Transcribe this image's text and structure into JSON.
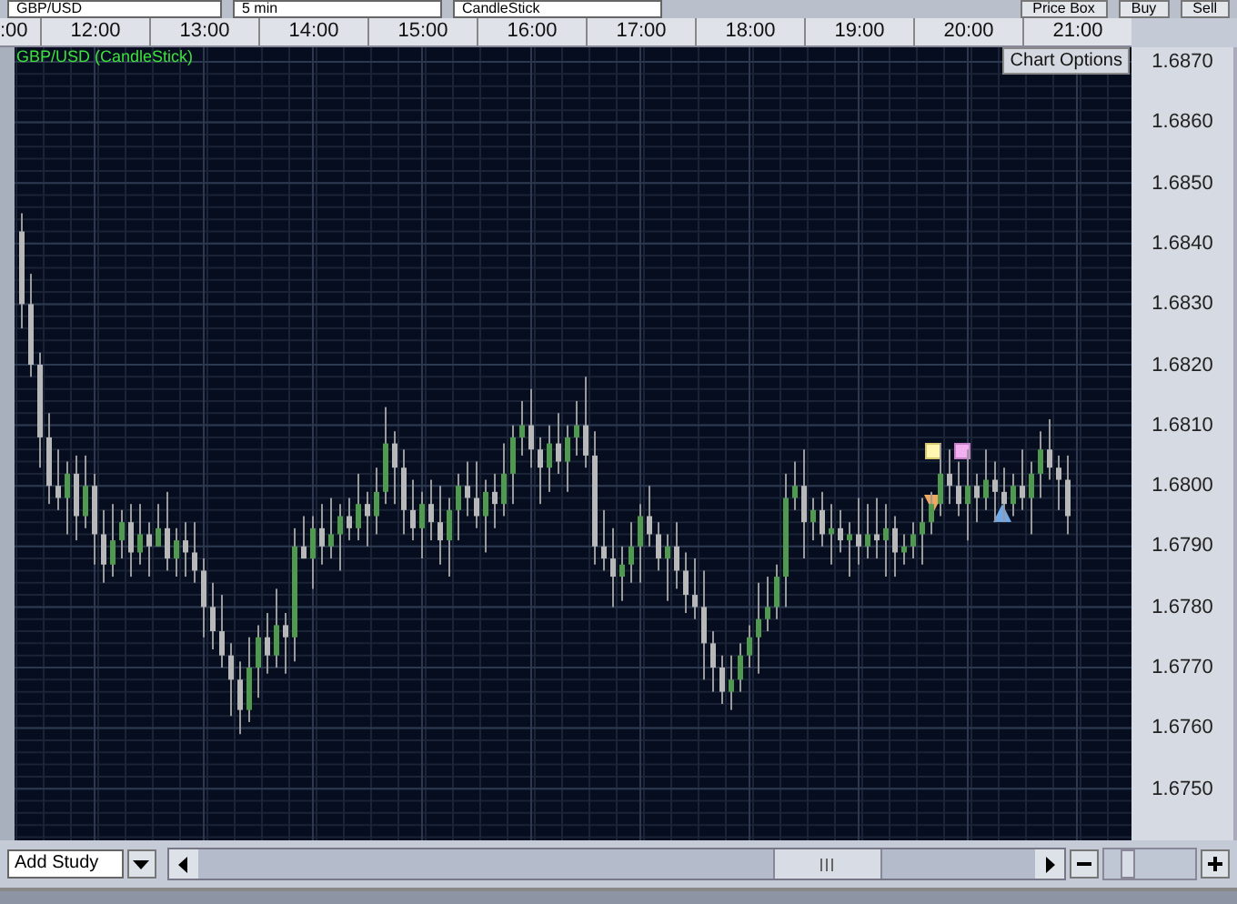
{
  "toolbar": {
    "symbol": "GBP/USD",
    "interval": "5 min",
    "chart_type": "CandleStick",
    "buttons": [
      "Price Box",
      "Buy",
      "Sell"
    ]
  },
  "chart": {
    "options_button": "Chart Options",
    "chart_data": {
      "type": "candlestick",
      "title": "GBP/USD (CandleStick)",
      "grid": true,
      "xlim": [
        11.2667,
        21.5
      ],
      "ylim": [
        1.67415,
        1.68724
      ],
      "xticks": [
        {
          "value": 12,
          "label": "12:00"
        },
        {
          "value": 13,
          "label": "13:00"
        },
        {
          "value": 14,
          "label": "14:00"
        },
        {
          "value": 15,
          "label": "15:00"
        },
        {
          "value": 16,
          "label": "16:00"
        },
        {
          "value": 17,
          "label": "17:00"
        },
        {
          "value": 18,
          "label": "18:00"
        },
        {
          "value": 19,
          "label": "19:00"
        },
        {
          "value": 20,
          "label": "20:00"
        },
        {
          "value": 21,
          "label": "21:00"
        }
      ],
      "yticks": [
        {
          "value": 1.687,
          "label": "1.6870"
        },
        {
          "value": 1.686,
          "label": "1.6860"
        },
        {
          "value": 1.685,
          "label": "1.6850"
        },
        {
          "value": 1.684,
          "label": "1.6840"
        },
        {
          "value": 1.683,
          "label": "1.6830"
        },
        {
          "value": 1.682,
          "label": "1.6820"
        },
        {
          "value": 1.681,
          "label": "1.6810"
        },
        {
          "value": 1.68,
          "label": "1.6800"
        },
        {
          "value": 1.679,
          "label": "1.6790"
        },
        {
          "value": 1.678,
          "label": "1.6780"
        },
        {
          "value": 1.677,
          "label": "1.6770"
        },
        {
          "value": 1.676,
          "label": "1.6760"
        },
        {
          "value": 1.675,
          "label": "1.6750"
        }
      ],
      "x": [
        11.3333,
        11.4167,
        11.5,
        11.5833,
        11.6667,
        11.75,
        11.8333,
        11.9167,
        12,
        12.0833,
        12.1667,
        12.25,
        12.3333,
        12.4167,
        12.5,
        12.5833,
        12.6667,
        12.75,
        12.8333,
        12.9167,
        13,
        13.0833,
        13.1667,
        13.25,
        13.3333,
        13.4167,
        13.5,
        13.5833,
        13.6667,
        13.75,
        13.8333,
        13.9167,
        14,
        14.0833,
        14.1667,
        14.25,
        14.3333,
        14.4167,
        14.5,
        14.5833,
        14.6667,
        14.75,
        14.8333,
        14.9167,
        15,
        15.0833,
        15.1667,
        15.25,
        15.3333,
        15.4167,
        15.5,
        15.5833,
        15.6667,
        15.75,
        15.8333,
        15.9167,
        16,
        16.0833,
        16.1667,
        16.25,
        16.3333,
        16.4167,
        16.5,
        16.5833,
        16.6667,
        16.75,
        16.8333,
        16.9167,
        17,
        17.0833,
        17.1667,
        17.25,
        17.3333,
        17.4167,
        17.5,
        17.5833,
        17.6667,
        17.75,
        17.8333,
        17.9167,
        18,
        18.0833,
        18.1667,
        18.25,
        18.3333,
        18.4167,
        18.5,
        18.5833,
        18.6667,
        18.75,
        18.8333,
        18.9167,
        19,
        19.0833,
        19.1667,
        19.25,
        19.3333,
        19.4167,
        19.5,
        19.5833,
        19.6667,
        19.75,
        19.8333,
        19.9167,
        20,
        20.0833,
        20.1667,
        20.25,
        20.3333,
        20.4167,
        20.5,
        20.5833,
        20.6667,
        20.75,
        20.8333,
        20.9167
      ],
      "ohlc": [
        [
          1.6842,
          1.6845,
          1.6826,
          1.683
        ],
        [
          1.683,
          1.6835,
          1.6818,
          1.682
        ],
        [
          1.682,
          1.6822,
          1.6803,
          1.6808
        ],
        [
          1.6808,
          1.6812,
          1.6797,
          1.68
        ],
        [
          1.68,
          1.6806,
          1.6796,
          1.6798
        ],
        [
          1.6798,
          1.6804,
          1.6792,
          1.6802
        ],
        [
          1.6802,
          1.6805,
          1.6791,
          1.6795
        ],
        [
          1.6795,
          1.6805,
          1.6793,
          1.68
        ],
        [
          1.68,
          1.6802,
          1.6787,
          1.6792
        ],
        [
          1.6792,
          1.6796,
          1.6784,
          1.6787
        ],
        [
          1.6787,
          1.6797,
          1.6785,
          1.6791
        ],
        [
          1.6791,
          1.6796,
          1.6788,
          1.6794
        ],
        [
          1.6794,
          1.6797,
          1.6785,
          1.6789
        ],
        [
          1.6789,
          1.6797,
          1.6787,
          1.6792
        ],
        [
          1.6792,
          1.6794,
          1.6785,
          1.679
        ],
        [
          1.679,
          1.6797,
          1.679,
          1.6793
        ],
        [
          1.6793,
          1.6799,
          1.6786,
          1.6788
        ],
        [
          1.6788,
          1.6793,
          1.6785,
          1.6791
        ],
        [
          1.6791,
          1.6794,
          1.6785,
          1.6789
        ],
        [
          1.6789,
          1.6794,
          1.6784,
          1.6786
        ],
        [
          1.6786,
          1.6788,
          1.6775,
          1.678
        ],
        [
          1.678,
          1.6784,
          1.6773,
          1.6776
        ],
        [
          1.6776,
          1.6782,
          1.677,
          1.6772
        ],
        [
          1.6772,
          1.6774,
          1.6762,
          1.6768
        ],
        [
          1.6768,
          1.6771,
          1.6759,
          1.6763
        ],
        [
          1.6763,
          1.6775,
          1.6761,
          1.677
        ],
        [
          1.677,
          1.6777,
          1.6765,
          1.6775
        ],
        [
          1.6775,
          1.6779,
          1.6769,
          1.6772
        ],
        [
          1.6772,
          1.6783,
          1.677,
          1.6777
        ],
        [
          1.6777,
          1.6779,
          1.6769,
          1.6775
        ],
        [
          1.6775,
          1.6793,
          1.6771,
          1.679
        ],
        [
          1.679,
          1.6795,
          1.6788,
          1.6788
        ],
        [
          1.6788,
          1.6795,
          1.6783,
          1.6793
        ],
        [
          1.6793,
          1.6797,
          1.6787,
          1.679
        ],
        [
          1.679,
          1.6798,
          1.6788,
          1.6792
        ],
        [
          1.6792,
          1.6797,
          1.6786,
          1.6795
        ],
        [
          1.6795,
          1.6798,
          1.6791,
          1.6793
        ],
        [
          1.6793,
          1.6802,
          1.6791,
          1.6797
        ],
        [
          1.6797,
          1.6799,
          1.679,
          1.6795
        ],
        [
          1.6795,
          1.6803,
          1.6792,
          1.6799
        ],
        [
          1.6799,
          1.6813,
          1.6797,
          1.6807
        ],
        [
          1.6807,
          1.6809,
          1.6797,
          1.6803
        ],
        [
          1.6803,
          1.6806,
          1.6792,
          1.6796
        ],
        [
          1.6796,
          1.6801,
          1.6791,
          1.6793
        ],
        [
          1.6793,
          1.6799,
          1.6788,
          1.6797
        ],
        [
          1.6797,
          1.6801,
          1.6791,
          1.6794
        ],
        [
          1.6794,
          1.68,
          1.6787,
          1.6791
        ],
        [
          1.6791,
          1.6798,
          1.6785,
          1.6796
        ],
        [
          1.6796,
          1.6802,
          1.6791,
          1.68
        ],
        [
          1.68,
          1.6804,
          1.6795,
          1.6798
        ],
        [
          1.6798,
          1.6804,
          1.6793,
          1.6795
        ],
        [
          1.6795,
          1.6801,
          1.6789,
          1.6799
        ],
        [
          1.6799,
          1.6802,
          1.6793,
          1.6797
        ],
        [
          1.6797,
          1.6807,
          1.6795,
          1.6802
        ],
        [
          1.6802,
          1.681,
          1.6797,
          1.6808
        ],
        [
          1.6808,
          1.6814,
          1.6805,
          1.681
        ],
        [
          1.681,
          1.6816,
          1.6803,
          1.6806
        ],
        [
          1.6806,
          1.6808,
          1.6797,
          1.6803
        ],
        [
          1.6803,
          1.681,
          1.6799,
          1.6807
        ],
        [
          1.6807,
          1.6812,
          1.6802,
          1.6804
        ],
        [
          1.6804,
          1.681,
          1.6799,
          1.6808
        ],
        [
          1.6808,
          1.6814,
          1.6805,
          1.681
        ],
        [
          1.681,
          1.6818,
          1.6803,
          1.6805
        ],
        [
          1.6805,
          1.6809,
          1.6787,
          1.679
        ],
        [
          1.679,
          1.6796,
          1.6786,
          1.6788
        ],
        [
          1.6788,
          1.6793,
          1.678,
          1.6785
        ],
        [
          1.6785,
          1.679,
          1.6781,
          1.6787
        ],
        [
          1.6787,
          1.6794,
          1.6784,
          1.679
        ],
        [
          1.679,
          1.6797,
          1.6784,
          1.6795
        ],
        [
          1.6795,
          1.68,
          1.679,
          1.6792
        ],
        [
          1.6792,
          1.6794,
          1.6786,
          1.6788
        ],
        [
          1.6788,
          1.6792,
          1.6781,
          1.679
        ],
        [
          1.679,
          1.6794,
          1.6783,
          1.6786
        ],
        [
          1.6786,
          1.6789,
          1.6779,
          1.6782
        ],
        [
          1.6782,
          1.6788,
          1.6778,
          1.678
        ],
        [
          1.678,
          1.6786,
          1.6768,
          1.6774
        ],
        [
          1.6774,
          1.6776,
          1.6766,
          1.677
        ],
        [
          1.677,
          1.6772,
          1.6764,
          1.6766
        ],
        [
          1.6766,
          1.6772,
          1.6763,
          1.6768
        ],
        [
          1.6768,
          1.6774,
          1.6766,
          1.6772
        ],
        [
          1.6772,
          1.6777,
          1.677,
          1.6775
        ],
        [
          1.6775,
          1.6784,
          1.6769,
          1.6778
        ],
        [
          1.6778,
          1.6785,
          1.6776,
          1.678
        ],
        [
          1.678,
          1.6787,
          1.6778,
          1.6785
        ],
        [
          1.6785,
          1.6802,
          1.678,
          1.6798
        ],
        [
          1.6798,
          1.6804,
          1.6796,
          1.68
        ],
        [
          1.68,
          1.6806,
          1.6788,
          1.6794
        ],
        [
          1.6794,
          1.6798,
          1.6791,
          1.6796
        ],
        [
          1.6796,
          1.6799,
          1.679,
          1.6792
        ],
        [
          1.6792,
          1.6797,
          1.6787,
          1.6793
        ],
        [
          1.6793,
          1.6796,
          1.6789,
          1.6791
        ],
        [
          1.6791,
          1.6794,
          1.6785,
          1.6792
        ],
        [
          1.6792,
          1.6798,
          1.6787,
          1.679
        ],
        [
          1.679,
          1.6797,
          1.6788,
          1.6792
        ],
        [
          1.6792,
          1.6798,
          1.6788,
          1.6791
        ],
        [
          1.6791,
          1.6797,
          1.6785,
          1.6793
        ],
        [
          1.6793,
          1.6795,
          1.6785,
          1.6789
        ],
        [
          1.6789,
          1.6792,
          1.6787,
          1.679
        ],
        [
          1.679,
          1.6794,
          1.6788,
          1.6792
        ],
        [
          1.6792,
          1.6798,
          1.6787,
          1.6794
        ],
        [
          1.6794,
          1.6799,
          1.6792,
          1.6797
        ],
        [
          1.6797,
          1.6807,
          1.6795,
          1.6802
        ],
        [
          1.6802,
          1.6806,
          1.6797,
          1.68
        ],
        [
          1.68,
          1.6804,
          1.6795,
          1.6797
        ],
        [
          1.6797,
          1.6806,
          1.6791,
          1.68
        ],
        [
          1.68,
          1.6802,
          1.6794,
          1.6798
        ],
        [
          1.6798,
          1.6806,
          1.6796,
          1.6801
        ],
        [
          1.6801,
          1.6804,
          1.6794,
          1.6799
        ],
        [
          1.6799,
          1.6803,
          1.6794,
          1.6797
        ],
        [
          1.6797,
          1.6802,
          1.6795,
          1.68
        ],
        [
          1.68,
          1.6806,
          1.6796,
          1.6798
        ],
        [
          1.6798,
          1.6804,
          1.6792,
          1.6802
        ],
        [
          1.6802,
          1.6809,
          1.6798,
          1.6806
        ],
        [
          1.6806,
          1.6811,
          1.6801,
          1.6803
        ],
        [
          1.6803,
          1.6805,
          1.6796,
          1.6801
        ],
        [
          1.6801,
          1.6805,
          1.6792,
          1.6795
        ]
      ]
    }
  },
  "time_axis_cut_label": ":00",
  "bottom_bar": {
    "add_study": "Add Study",
    "zoom_slider": {
      "level": 0.2
    }
  }
}
